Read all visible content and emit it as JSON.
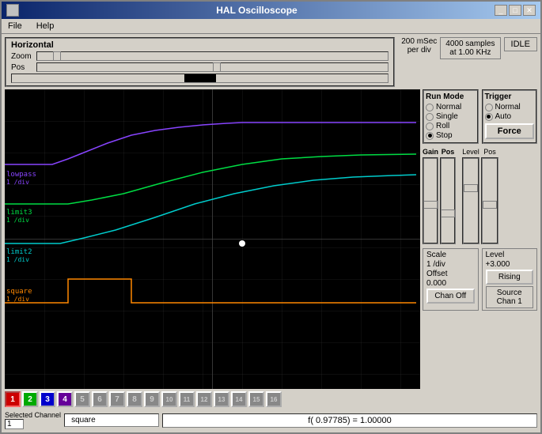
{
  "window": {
    "title": "HAL Oscilloscope"
  },
  "titlebar": {
    "minimize": "_",
    "maximize": "□",
    "close": "✕"
  },
  "menu": {
    "file": "File",
    "help": "Help"
  },
  "horizontal": {
    "label": "Horizontal",
    "zoom_label": "Zoom",
    "pos_label": "Pos",
    "time_per_div": "200 mSec",
    "per_div": "per div",
    "samples": "4000 samples",
    "at_freq": "at 1.00 KHz"
  },
  "status": {
    "idle": "IDLE"
  },
  "run_mode": {
    "title": "Run Mode",
    "normal": "Normal",
    "single": "Single",
    "roll": "Roll",
    "stop": "Stop",
    "stop_selected": true
  },
  "trigger": {
    "title": "Trigger",
    "normal": "Normal",
    "auto": "Auto",
    "auto_selected": true,
    "force": "Force",
    "level_label": "Level",
    "pos_label": "Pos"
  },
  "vertical": {
    "gain_label": "Gain",
    "pos_label": "Pos"
  },
  "scale_offset": {
    "scale_label": "Scale",
    "scale_value": "1 /div",
    "offset_label": "Offset",
    "offset_value": "0.000",
    "level_label": "Level",
    "level_value": "+3.000",
    "rising_label": "Rising",
    "chan_off_label": "Chan Off"
  },
  "source_chan": {
    "source_label": "Source",
    "chan_label": "Chan 1"
  },
  "channels": {
    "active": [
      {
        "num": 1,
        "color": "#ff0000",
        "selected": true
      },
      {
        "num": 2,
        "color": "#00ff00",
        "selected": false
      },
      {
        "num": 3,
        "color": "#0000ff",
        "selected": false
      },
      {
        "num": 4,
        "color": "#800080",
        "selected": false
      },
      {
        "num": 5,
        "color": "#808080",
        "selected": false
      },
      {
        "num": 6,
        "color": "#808080",
        "selected": false
      },
      {
        "num": 7,
        "color": "#808080",
        "selected": false
      },
      {
        "num": 8,
        "color": "#808080",
        "selected": false
      },
      {
        "num": 9,
        "color": "#808080",
        "selected": false
      },
      {
        "num": 10,
        "color": "#808080",
        "selected": false
      },
      {
        "num": 11,
        "color": "#808080",
        "selected": false
      },
      {
        "num": 12,
        "color": "#808080",
        "selected": false
      },
      {
        "num": 13,
        "color": "#808080",
        "selected": false
      },
      {
        "num": 14,
        "color": "#808080",
        "selected": false
      },
      {
        "num": 15,
        "color": "#808080",
        "selected": false
      },
      {
        "num": 16,
        "color": "#808080",
        "selected": false
      }
    ]
  },
  "selected_channel": {
    "label": "Selected Channel",
    "value": "1",
    "signal_name": "square"
  },
  "function_display": {
    "text": "f( 0.97785) =  1.00000"
  },
  "channel_labels": [
    {
      "name": "lowpass",
      "scale": "1 /div",
      "color": "#00bfff",
      "y_pct": 53
    },
    {
      "name": "limit3",
      "scale": "1 /div",
      "color": "#00ffaa",
      "y_pct": 63
    },
    {
      "name": "limit2",
      "scale": "1 /div",
      "color": "#00cccc",
      "y_pct": 76
    },
    {
      "name": "square",
      "scale": "1 /div",
      "color": "#ff8800",
      "y_pct": 88
    }
  ]
}
